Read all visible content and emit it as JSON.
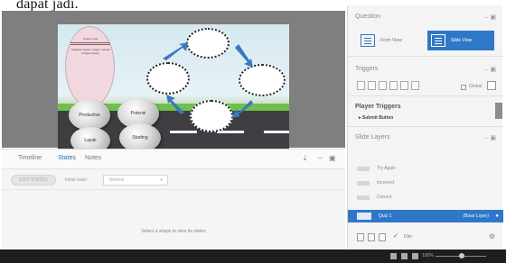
{
  "page": {
    "cropped_heading": "dapat jadi."
  },
  "slide": {
    "info_title": "Aturan Goal",
    "info_body": "Tetapkan tujuan / target / sesuai dengan tujuan",
    "spheres": [
      "Productive",
      "Potensi",
      "Layak",
      "Starting"
    ]
  },
  "timeline": {
    "tabs": [
      "Timeline",
      "States",
      "Notes"
    ],
    "edit_states": "EDIT STATES",
    "initial_state_label": "Initial state:",
    "initial_state_value": "Normal",
    "empty_message": "Select a shape to view its states"
  },
  "right": {
    "question_title": "Question",
    "form_view": "Form View",
    "slide_view": "Slide View",
    "triggers_title": "Triggers",
    "global_label": "Global",
    "player_triggers_title": "Player Triggers",
    "player_trigger_item": "Submit Button",
    "slide_layers_title": "Slide Layers",
    "layers": [
      "Try Again",
      "Incorrect",
      "Correct",
      "Quiz 1"
    ],
    "base_layer_tag": "(Base Layer)",
    "dim_label": "Dim"
  },
  "status": {
    "zoom": "100%"
  },
  "colors": {
    "accent": "#2f78c8",
    "status_bar": "#1e1e1e",
    "stage_bg": "#7f7f7f"
  }
}
